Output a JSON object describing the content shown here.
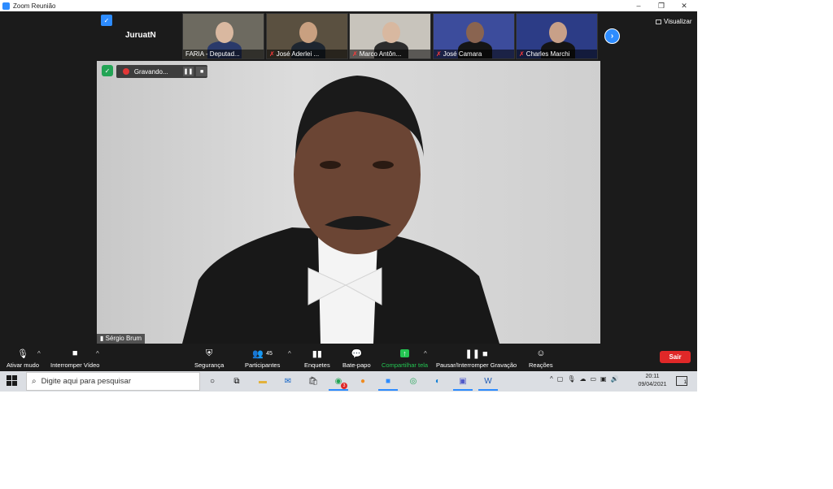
{
  "window": {
    "title": "Zoom Reunião",
    "minimize": "–",
    "restore": "❐",
    "close": "✕"
  },
  "meeting": {
    "name": "JuruatN",
    "view_label": "Visualizar"
  },
  "thumbnails": [
    {
      "label": "FARIA - Deputad...",
      "muted": false,
      "bg": "#6d6a60",
      "skin": "#d9b8a0",
      "shirt": "#2a3a6a"
    },
    {
      "label": "José Aderlei ...",
      "muted": true,
      "bg": "#5a5040",
      "skin": "#c9a080",
      "shirt": "#1e2630"
    },
    {
      "label": "Marco Antôn...",
      "muted": true,
      "bg": "#c8c4bc",
      "skin": "#d8b8a0",
      "shirt": "#2c2c2c"
    },
    {
      "label": "José Camara",
      "muted": true,
      "bg": "#3c4c9c",
      "skin": "#8a6450",
      "shirt": "#151515"
    },
    {
      "label": "Charles Marchi",
      "muted": true,
      "bg": "#2c3c86",
      "skin": "#c8a088",
      "shirt": "#141414"
    }
  ],
  "recording": {
    "label": "Gravando...",
    "pause": "❚❚",
    "stop": "■"
  },
  "speaker": {
    "name": "Sérgio Brum"
  },
  "toolbar": {
    "mute": "Ativar mudo",
    "video": "Interromper Vídeo",
    "security": "Segurança",
    "participants": "Participantes",
    "participants_count": "45",
    "polls": "Enquetes",
    "chat": "Bate-papo",
    "share": "Compartilhar tela",
    "record": "Pausar/Interromper Gravação",
    "reactions": "Reações",
    "leave": "Sair"
  },
  "taskbar": {
    "search_placeholder": "Digite aqui para pesquisar",
    "time": "20:11",
    "date": "09/04/2021",
    "notif_count": "1",
    "chrome_badge": "3"
  },
  "colors": {
    "zoom_blue": "#2d8cff",
    "leave_red": "#e02828",
    "share_green": "#23c552",
    "toolbar_bg": "#1b1b1b"
  }
}
